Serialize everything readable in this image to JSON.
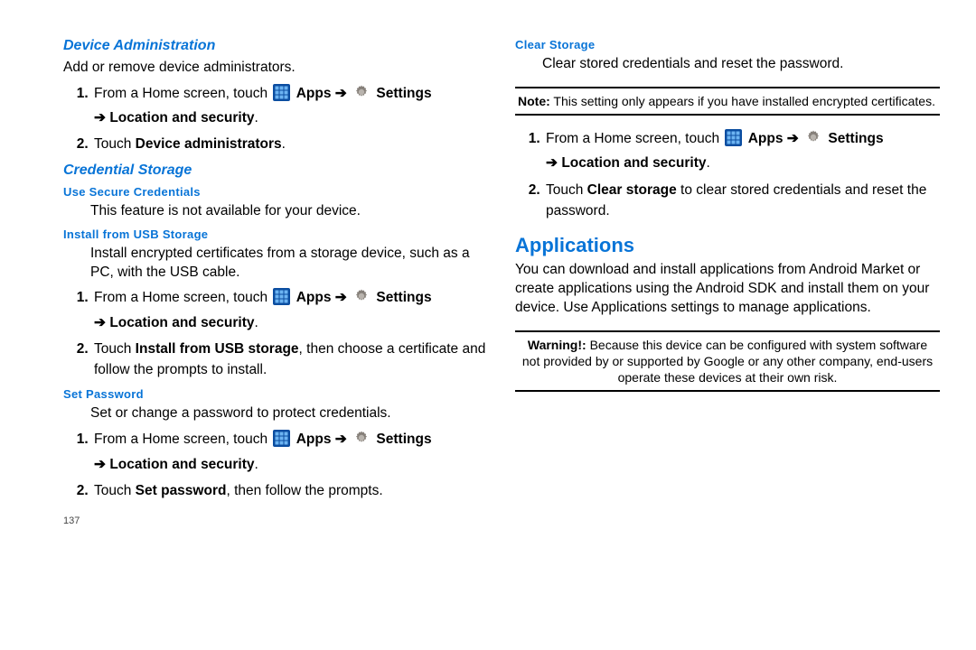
{
  "left": {
    "device_admin": {
      "heading": "Device Administration",
      "intro": "Add or remove device administrators.",
      "step1_a": "From a Home screen, touch ",
      "apps": "Apps",
      "settings": "Settings",
      "step1_b": " Location and security",
      "step2_a": "Touch ",
      "step2_b": "Device administrators",
      "step2_c": "."
    },
    "cred": {
      "heading": "Credential Storage",
      "use_sec": "Use Secure Credentials",
      "use_sec_body": "This feature is not available for your device.",
      "install": "Install from USB Storage",
      "install_body": "Install encrypted certificates from a storage device, such as a PC, with the USB cable.",
      "inst_s1_a": "From a Home screen, touch ",
      "inst_s1_b": " Location and security",
      "inst_s2_a": "Touch ",
      "inst_s2_b": "Install from USB storage",
      "inst_s2_c": ", then choose a certificate and follow the prompts to install.",
      "setpw": "Set Password",
      "setpw_body": "Set or change a password to protect credentials.",
      "sp_s1_a": "From a Home screen, touch ",
      "sp_s1_b": " Location and security",
      "sp_s2_a": "Touch ",
      "sp_s2_b": "Set password",
      "sp_s2_c": ", then follow the prompts."
    },
    "pageno": "137"
  },
  "right": {
    "clear": {
      "heading": "Clear Storage",
      "intro": "Clear stored credentials and reset the password.",
      "note_b": "Note:",
      "note": " This setting only appears if you have installed encrypted certificates.",
      "s1_a": "From a Home screen, touch ",
      "s1_b": " Location and security",
      "s2_a": "Touch ",
      "s2_b": "Clear storage",
      "s2_c": " to clear stored credentials and reset the password."
    },
    "apps_h": "Applications",
    "apps_body": "You can download and install applications from Android Market or create applications using the Android SDK and install them on your device. Use Applications settings to manage applications.",
    "warn_b": "Warning!:",
    "warn": " Because this device can be configured with system software not provided by or supported by Google or any other company, end-users operate these devices at their own risk."
  },
  "common": {
    "apps": "Apps",
    "settings": "Settings",
    "arrow": "➔",
    "arrow2": "➔",
    "period": "."
  }
}
